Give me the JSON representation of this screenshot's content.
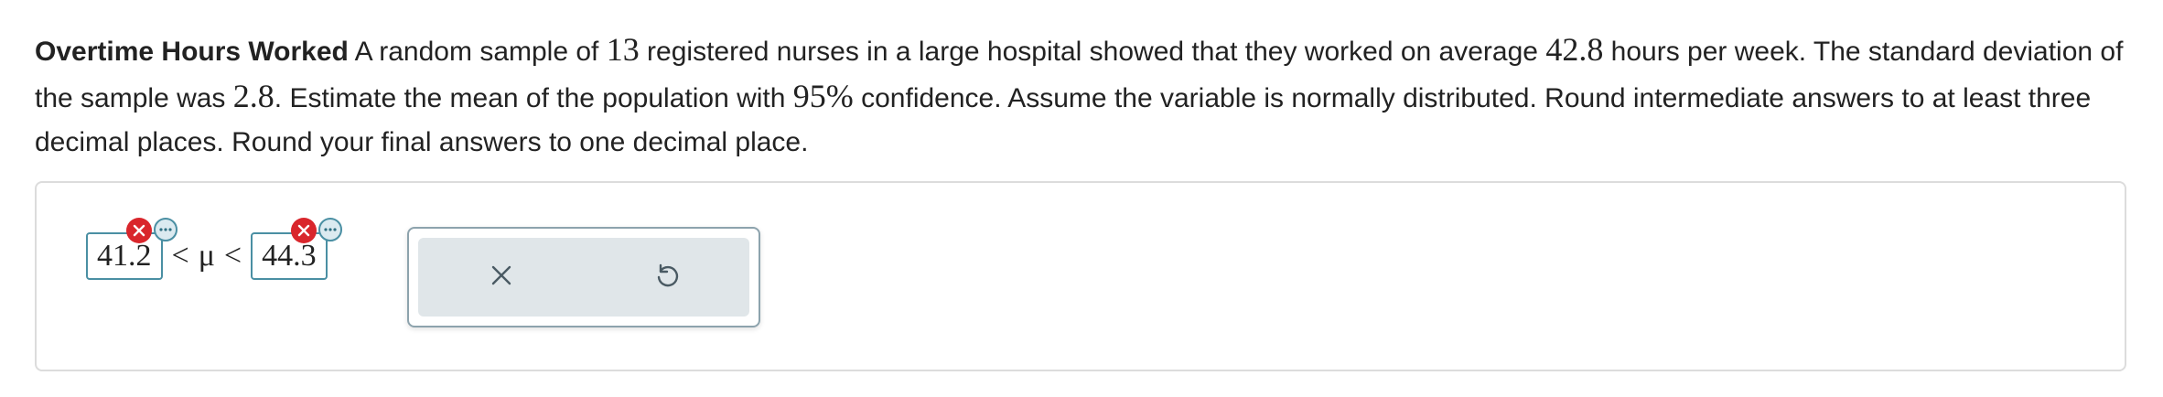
{
  "problem": {
    "title": "Overtime Hours Worked",
    "t1": " A random sample of ",
    "n": "13",
    "t2": " registered nurses in a large hospital showed that they worked on average ",
    "mean": "42.8",
    "t3": " hours per week. The standard deviation of the sample was ",
    "sd": "2.8",
    "t4": ". Estimate the mean of the population with ",
    "conf": "95%",
    "t5": " confidence. Assume the variable is normally distributed. Round intermediate answers to at least three decimal places. Round your final answers to one decimal place."
  },
  "answer": {
    "lower_value": "41.2",
    "lt1": "<",
    "mu": "μ",
    "lt2": "<",
    "upper_value": "44.3",
    "lower_status": "incorrect",
    "upper_status": "incorrect"
  },
  "icons": {
    "error_badge": "x-circle-icon",
    "more_badge": "ellipsis-icon",
    "clear": "close-icon",
    "undo": "undo-icon"
  },
  "colors": {
    "error": "#d9262c",
    "accent": "#4a8fa3",
    "tool_bg": "#e0e6e9"
  }
}
